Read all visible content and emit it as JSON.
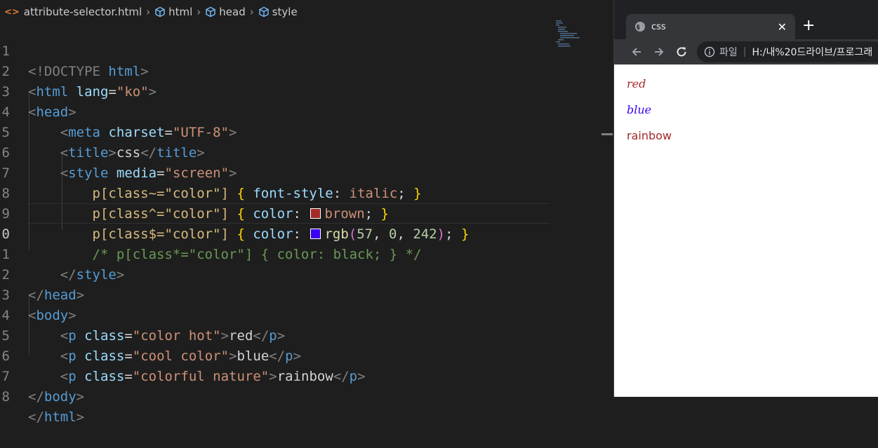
{
  "breadcrumb": {
    "file": "attribute-selector.html",
    "items": [
      "html",
      "head",
      "style"
    ]
  },
  "code": {
    "line_numbers": [
      "1",
      "2",
      "3",
      "4",
      "5",
      "6",
      "7",
      "8",
      "9",
      "0",
      "1",
      "2",
      "3",
      "4",
      "5",
      "6",
      "7",
      "8"
    ],
    "l1_doctype": "<!DOCTYPE",
    "l1_html": "html",
    "l1_close": ">",
    "l2_open": "<",
    "l2_tag": "html",
    "l2_attr": "lang",
    "l2_val": "\"ko\"",
    "l2_close": ">",
    "l3_tag": "head",
    "l4_tag": "meta",
    "l4_attr": "charset",
    "l4_val": "\"UTF-8\"",
    "l5_tag": "title",
    "l5_text": "css",
    "l6_tag": "style",
    "l6_attr": "media",
    "l6_val": "\"screen\"",
    "l7_sel": "p[class~=\"color\"]",
    "l7_prop": "font-style",
    "l7_val": "italic",
    "l8_sel": "p[class^=\"color\"]",
    "l8_prop": "color",
    "l8_val": "brown",
    "l8_swatch": "#a52a2a",
    "l9_sel": "p[class$=\"color\"]",
    "l9_prop": "color",
    "l9_fn": "rgb",
    "l9_a": "57",
    "l9_b": "0",
    "l9_c": "242",
    "l9_swatch": "#3900f2",
    "l10_comment": "/* p[class*=\"color\"] { color: black; } */",
    "l14_attr": "class",
    "l14_val": "\"color hot\"",
    "l14_text": "red",
    "l15_val": "\"cool color\"",
    "l15_text": "blue",
    "l16_val": "\"colorful nature\"",
    "l16_text": "rainbow",
    "tag_body": "body",
    "tag_p": "p"
  },
  "browser": {
    "tab_title": "css",
    "new_tab": "+",
    "scheme_label": "파일",
    "url": "H:/내%20드라이브/프로그래",
    "paragraphs": [
      "red",
      "blue",
      "rainbow"
    ]
  },
  "colors": {
    "brown": "#a52a2a",
    "blue": "#3900f2",
    "editor_bg": "#1e1e1e"
  }
}
